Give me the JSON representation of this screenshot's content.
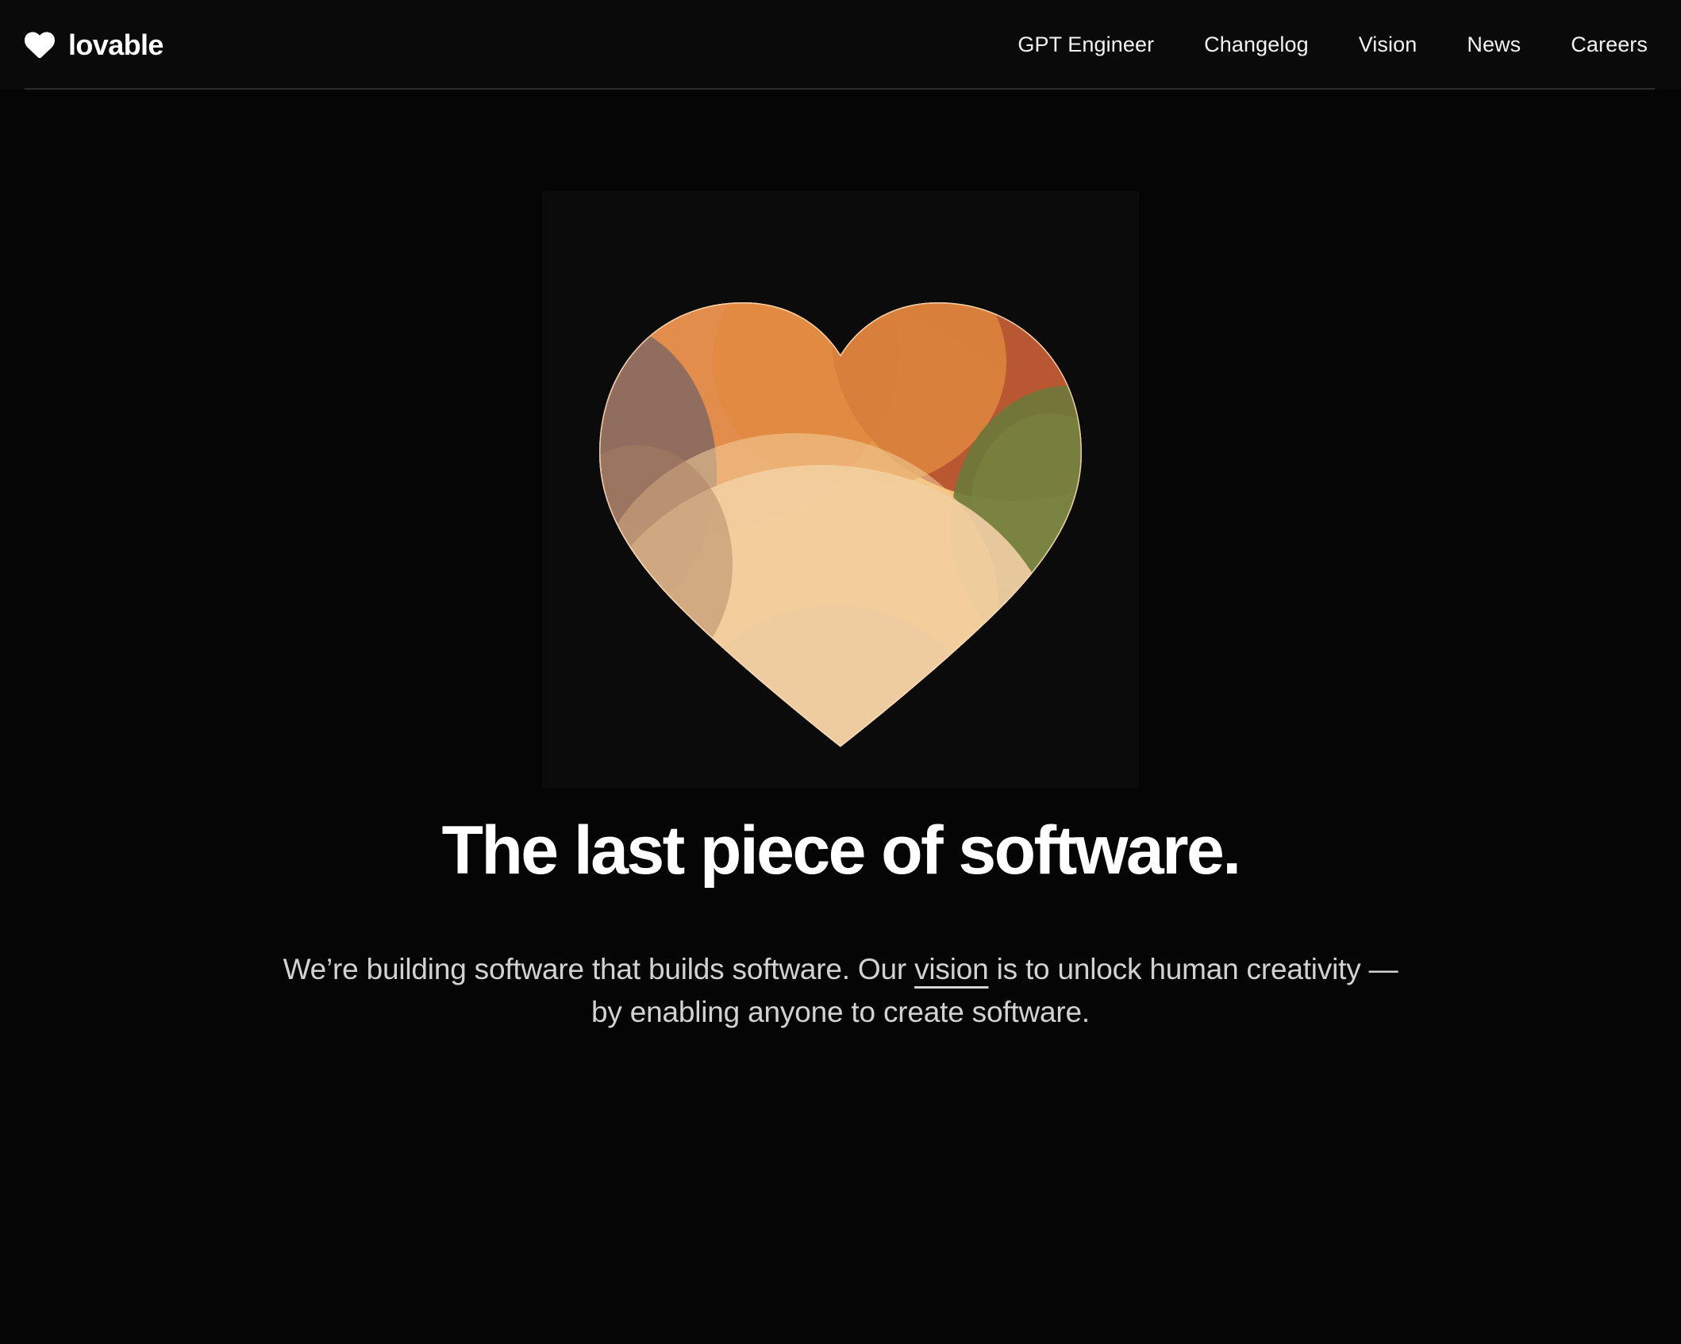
{
  "theme": {
    "background": "#050505",
    "header_background": "#0a0a0a",
    "header_border": "#2b2c2e",
    "text_primary": "#ffffff",
    "text_secondary": "#d2d2d2",
    "figure_background": "#0b0b0b"
  },
  "header": {
    "brand": {
      "name": "lovable",
      "icon": "heart-icon",
      "icon_color": "#ffffff"
    },
    "nav": [
      {
        "label": "GPT Engineer"
      },
      {
        "label": "Changelog"
      },
      {
        "label": "Vision"
      },
      {
        "label": "News"
      },
      {
        "label": "Careers"
      }
    ]
  },
  "hero": {
    "figure": {
      "name": "gradient-heart-illustration",
      "alt": "Gradient heart",
      "gradient_colors": {
        "top_left_lobe": "#e08a4a",
        "top_right_lobe": "#b55430",
        "left_edge": "#8a6a5e",
        "right_edge_green": "#6b7a3a",
        "center": "#efb968",
        "bottom_tip": "#e8c6a8",
        "rim_highlight": "#f6d9b4"
      }
    },
    "title": "The last piece of software.",
    "subtitle": {
      "part1": "We’re building software that builds software. Our ",
      "link": "vision",
      "part2": " is to unlock human creativity — by enabling anyone to create software."
    }
  }
}
